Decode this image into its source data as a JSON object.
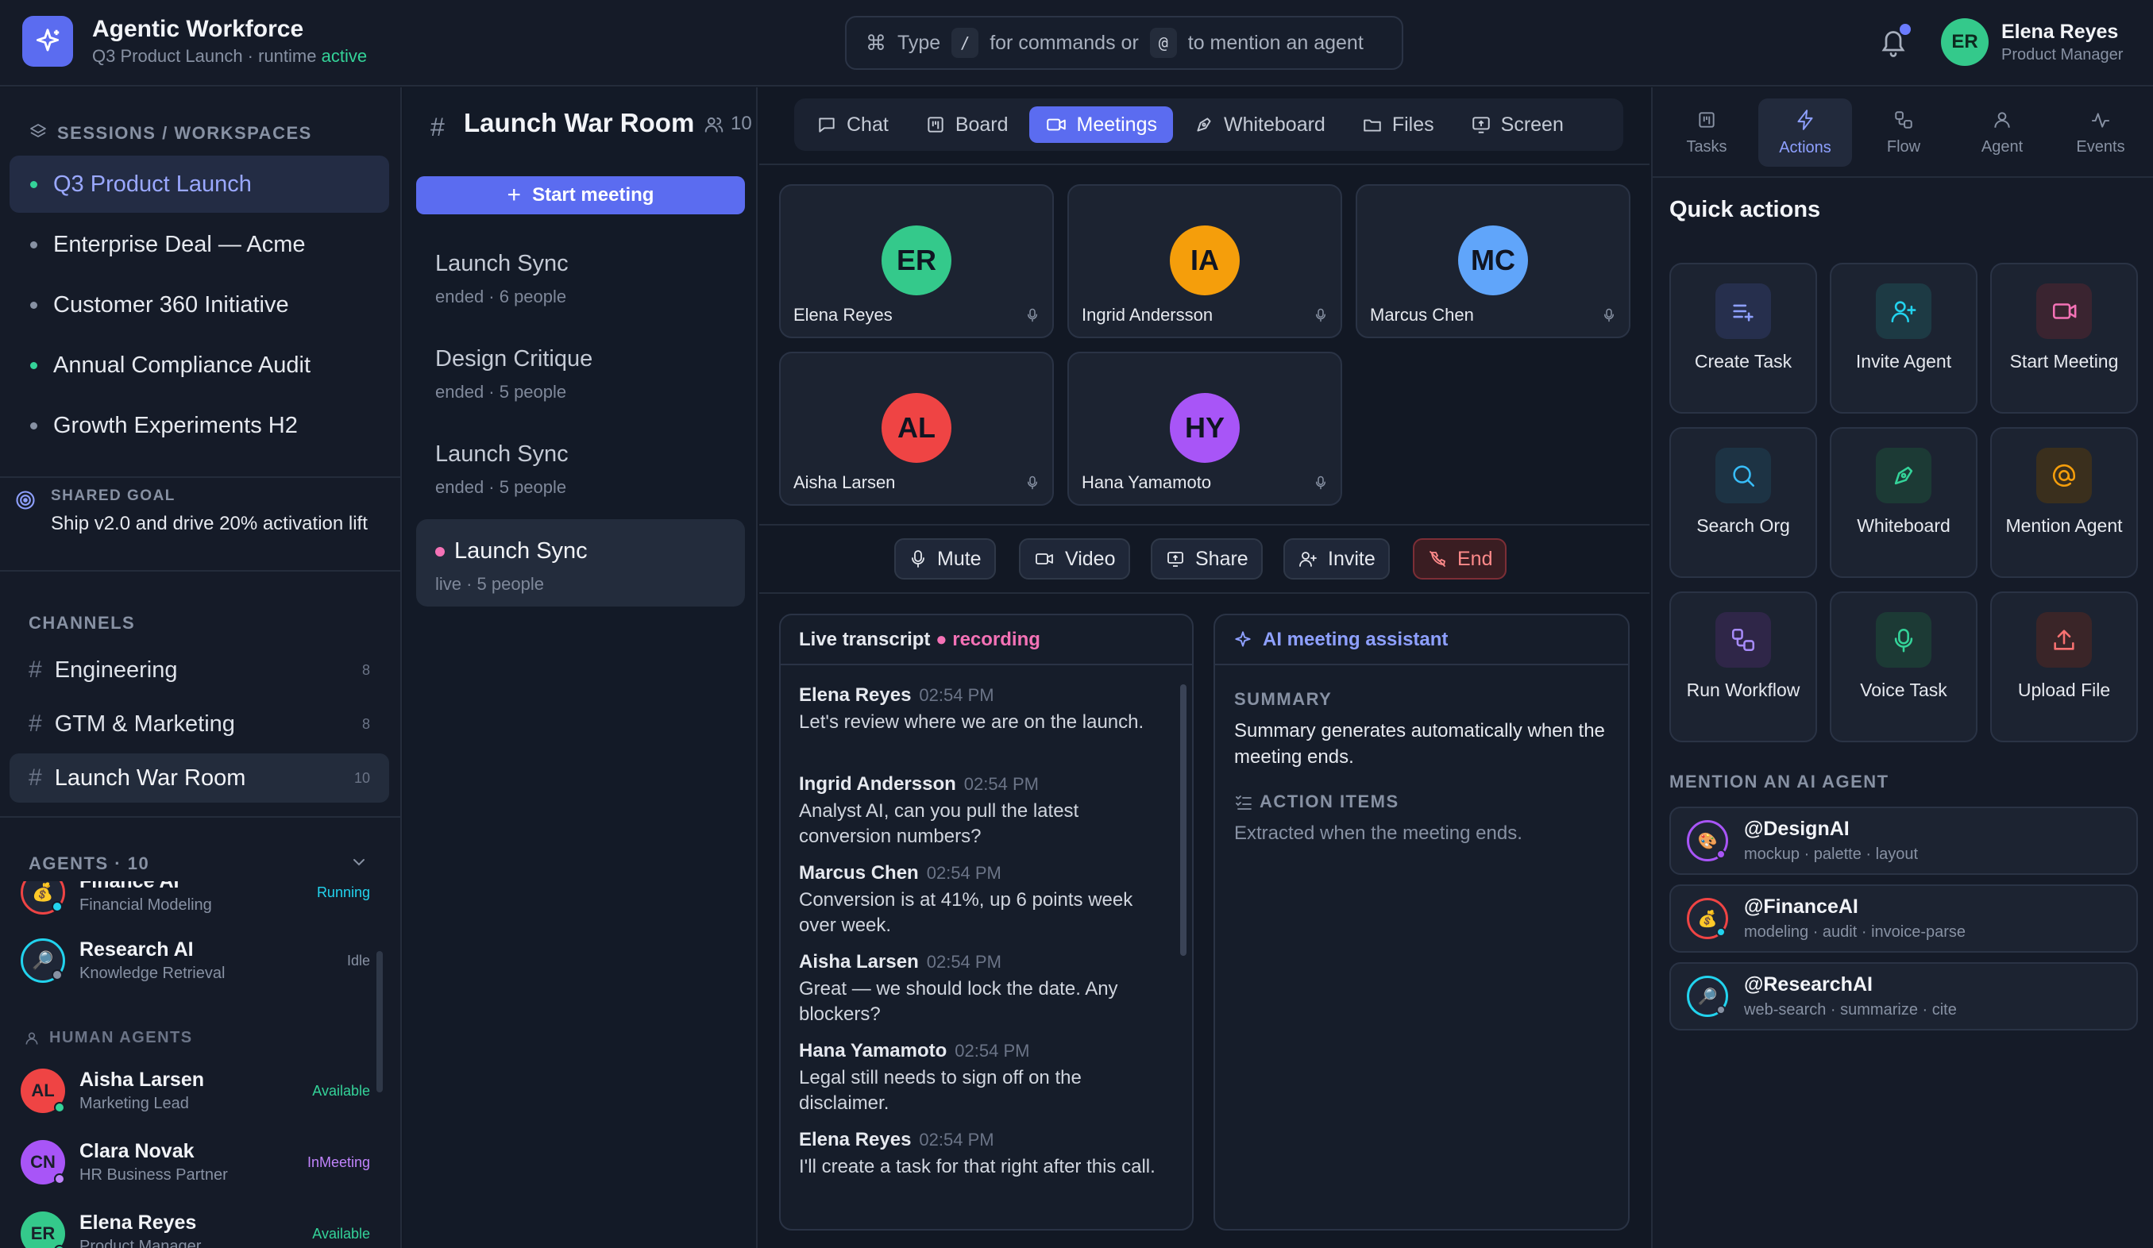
{
  "app": {
    "title": "Agentic Workforce",
    "subtitle_prefix": "Q3 Product Launch · runtime ",
    "subtitle_status": "active",
    "logo_icon": "sparkles-icon"
  },
  "command_bar": {
    "type_label": "Type",
    "slash_key": "/",
    "middle_text": "for commands or",
    "at_key": "@",
    "end_text": "to mention an agent"
  },
  "user": {
    "initials": "ER",
    "name": "Elena Reyes",
    "role": "Product Manager"
  },
  "sidebar": {
    "sessions_label": "SESSIONS / WORKSPACES",
    "workspaces": [
      {
        "label": "Q3 Product Launch",
        "status_color": "#34d399"
      },
      {
        "label": "Enterprise Deal — Acme",
        "status_color": "#8791a3"
      },
      {
        "label": "Customer 360 Initiative",
        "status_color": "#8791a3"
      },
      {
        "label": "Annual Compliance Audit",
        "status_color": "#34d399"
      },
      {
        "label": "Growth Experiments H2",
        "status_color": "#8791a3"
      }
    ],
    "goal": {
      "label": "SHARED GOAL",
      "text": "Ship v2.0 and drive 20% activation lift"
    },
    "channels_label": "CHANNELS",
    "channels": [
      {
        "name": "Engineering",
        "count": "8"
      },
      {
        "name": "GTM & Marketing",
        "count": "8"
      },
      {
        "name": "Launch War Room",
        "count": "10"
      }
    ],
    "agents_label": "AGENTS · 10",
    "human_agents_label": "HUMAN AGENTS",
    "ai_agents": [
      {
        "name": "Finance AI",
        "role": "Financial Modeling",
        "status": "Running",
        "status_color": "#22d3ee"
      },
      {
        "name": "Research AI",
        "role": "Knowledge Retrieval",
        "status": "Idle",
        "status_color": "#8791a3"
      }
    ],
    "human_agents": [
      {
        "initials": "AL",
        "name": "Aisha Larsen",
        "role": "Marketing Lead",
        "status": "Available",
        "status_color": "#34d399",
        "color": "#ef4444"
      },
      {
        "initials": "CN",
        "name": "Clara Novak",
        "role": "HR Business Partner",
        "status": "InMeeting",
        "status_color": "#c084fc",
        "color": "#a855f7"
      },
      {
        "initials": "ER",
        "name": "Elena Reyes",
        "role": "Product Manager",
        "status": "Available",
        "status_color": "#34d399",
        "color": "#34c98b"
      }
    ]
  },
  "channel_header": {
    "title": "Launch War Room",
    "members": "10"
  },
  "tabs": [
    {
      "label": "Chat",
      "icon": "chat-icon"
    },
    {
      "label": "Board",
      "icon": "board-icon"
    },
    {
      "label": "Meetings",
      "icon": "video-icon"
    },
    {
      "label": "Whiteboard",
      "icon": "pen-icon"
    },
    {
      "label": "Files",
      "icon": "folder-icon"
    },
    {
      "label": "Screen",
      "icon": "screen-share-icon"
    }
  ],
  "meetings": {
    "start_label": "Start meeting",
    "list": [
      {
        "title": "Launch Sync",
        "sub": "ended · 6 people"
      },
      {
        "title": "Design Critique",
        "sub": "ended · 5 people"
      },
      {
        "title": "Launch Sync",
        "sub": "ended · 5 people"
      },
      {
        "title": "Launch Sync",
        "sub": "live · 5 people"
      }
    ]
  },
  "participants": [
    {
      "initials": "ER",
      "name": "Elena Reyes",
      "color": "#34c98b"
    },
    {
      "initials": "IA",
      "name": "Ingrid Andersson",
      "color": "#f59e0b"
    },
    {
      "initials": "MC",
      "name": "Marcus Chen",
      "color": "#60a5fa"
    },
    {
      "initials": "AL",
      "name": "Aisha Larsen",
      "color": "#ef4444"
    },
    {
      "initials": "HY",
      "name": "Hana Yamamoto",
      "color": "#a855f7"
    }
  ],
  "controls": {
    "mute": "Mute",
    "video": "Video",
    "share": "Share",
    "invite": "Invite",
    "end": "End"
  },
  "transcript": {
    "title": "Live transcript",
    "recording": "recording",
    "entries": [
      {
        "name": "Elena Reyes",
        "time": "02:54 PM",
        "text": "Let's review where we are on the launch."
      },
      {
        "name": "Ingrid Andersson",
        "time": "02:54 PM",
        "text": "Analyst AI, can you pull the latest conversion numbers?"
      },
      {
        "name": "Marcus Chen",
        "time": "02:54 PM",
        "text": "Conversion is at 41%, up 6 points week over week."
      },
      {
        "name": "Aisha Larsen",
        "time": "02:54 PM",
        "text": "Great — we should lock the date. Any blockers?"
      },
      {
        "name": "Hana Yamamoto",
        "time": "02:54 PM",
        "text": "Legal still needs to sign off on the disclaimer."
      },
      {
        "name": "Elena Reyes",
        "time": "02:54 PM",
        "text": "I'll create a task for that right after this call."
      }
    ]
  },
  "assistant": {
    "title": "AI meeting assistant",
    "summary_label": "SUMMARY",
    "summary_text": "Summary generates automatically when the meeting ends.",
    "action_label": "ACTION ITEMS",
    "action_text": "Extracted when the meeting ends."
  },
  "right_tabs": [
    {
      "label": "Tasks",
      "icon": "tasks-icon"
    },
    {
      "label": "Actions",
      "icon": "bolt-icon"
    },
    {
      "label": "Flow",
      "icon": "flow-icon"
    },
    {
      "label": "Agent",
      "icon": "agent-icon"
    },
    {
      "label": "Events",
      "icon": "activity-icon"
    }
  ],
  "quick_actions": {
    "title": "Quick actions",
    "items": [
      {
        "label": "Create Task",
        "icon": "create-task-icon",
        "bg": "#262f4d",
        "fg": "#8ea0ff"
      },
      {
        "label": "Invite Agent",
        "icon": "invite-agent-icon",
        "bg": "#1d3a44",
        "fg": "#22d3ee"
      },
      {
        "label": "Start Meeting",
        "icon": "video-icon",
        "bg": "#3a2430",
        "fg": "#f472b6"
      },
      {
        "label": "Search Org",
        "icon": "search-icon",
        "bg": "#1d3344",
        "fg": "#38bdf8"
      },
      {
        "label": "Whiteboard",
        "icon": "pen-icon",
        "bg": "#1c3a35",
        "fg": "#34d399"
      },
      {
        "label": "Mention Agent",
        "icon": "at-icon",
        "bg": "#3a2f1d",
        "fg": "#f59e0b"
      },
      {
        "label": "Run Workflow",
        "icon": "workflow-icon",
        "bg": "#2f2648",
        "fg": "#a78bfa"
      },
      {
        "label": "Voice Task",
        "icon": "mic-icon",
        "bg": "#1c3a35",
        "fg": "#34d399"
      },
      {
        "label": "Upload File",
        "icon": "upload-icon",
        "bg": "#3a2528",
        "fg": "#f87171"
      }
    ]
  },
  "mentions": {
    "title": "MENTION AN AI AGENT",
    "items": [
      {
        "name": "@DesignAI",
        "sub": "mockup · palette · layout",
        "ring": "#a855f7",
        "status": "#a855f7",
        "emoji": "🎨"
      },
      {
        "name": "@FinanceAI",
        "sub": "modeling · audit · invoice-parse",
        "ring": "#ef4444",
        "status": "#22d3ee",
        "emoji": "💰"
      },
      {
        "name": "@ResearchAI",
        "sub": "web-search · summarize · cite",
        "ring": "#22d3ee",
        "status": "#8791a3",
        "emoji": "🔎"
      }
    ]
  }
}
